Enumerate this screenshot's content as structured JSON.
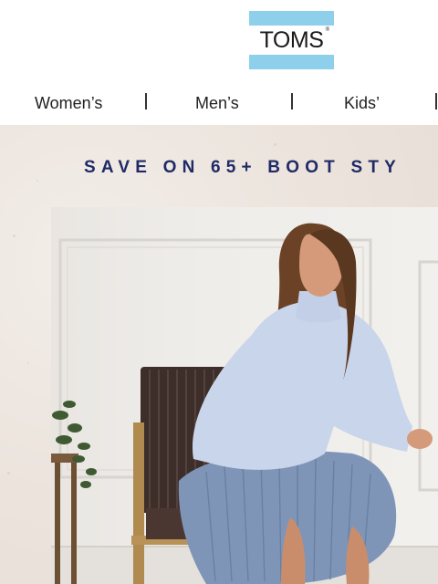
{
  "brand": {
    "name": "TOMS",
    "mark": "®",
    "bar_color": "#8ed0ec"
  },
  "nav": {
    "items": [
      {
        "label": "Women’s"
      },
      {
        "label": "Men’s"
      },
      {
        "label": "Kids’"
      }
    ]
  },
  "hero": {
    "headline": "SAVE ON 65+ BOOT STY",
    "headline_color": "#1f2a66"
  }
}
